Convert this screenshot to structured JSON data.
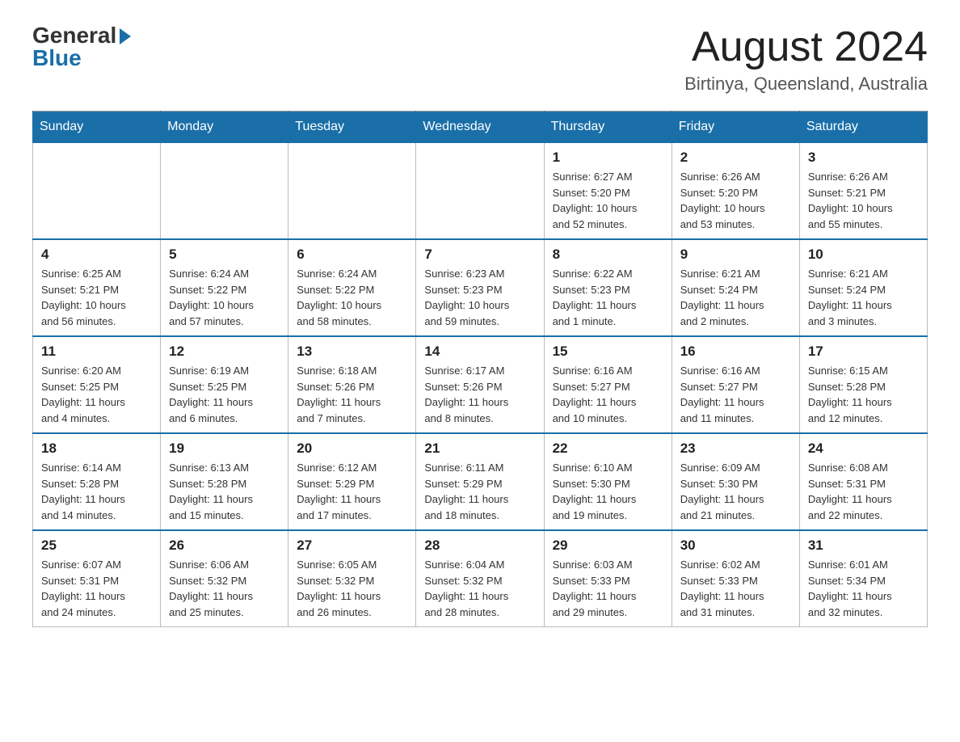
{
  "header": {
    "logo_general": "General",
    "logo_blue": "Blue",
    "month_title": "August 2024",
    "location": "Birtinya, Queensland, Australia"
  },
  "days_of_week": [
    "Sunday",
    "Monday",
    "Tuesday",
    "Wednesday",
    "Thursday",
    "Friday",
    "Saturday"
  ],
  "weeks": [
    [
      {
        "day": "",
        "info": ""
      },
      {
        "day": "",
        "info": ""
      },
      {
        "day": "",
        "info": ""
      },
      {
        "day": "",
        "info": ""
      },
      {
        "day": "1",
        "info": "Sunrise: 6:27 AM\nSunset: 5:20 PM\nDaylight: 10 hours\nand 52 minutes."
      },
      {
        "day": "2",
        "info": "Sunrise: 6:26 AM\nSunset: 5:20 PM\nDaylight: 10 hours\nand 53 minutes."
      },
      {
        "day": "3",
        "info": "Sunrise: 6:26 AM\nSunset: 5:21 PM\nDaylight: 10 hours\nand 55 minutes."
      }
    ],
    [
      {
        "day": "4",
        "info": "Sunrise: 6:25 AM\nSunset: 5:21 PM\nDaylight: 10 hours\nand 56 minutes."
      },
      {
        "day": "5",
        "info": "Sunrise: 6:24 AM\nSunset: 5:22 PM\nDaylight: 10 hours\nand 57 minutes."
      },
      {
        "day": "6",
        "info": "Sunrise: 6:24 AM\nSunset: 5:22 PM\nDaylight: 10 hours\nand 58 minutes."
      },
      {
        "day": "7",
        "info": "Sunrise: 6:23 AM\nSunset: 5:23 PM\nDaylight: 10 hours\nand 59 minutes."
      },
      {
        "day": "8",
        "info": "Sunrise: 6:22 AM\nSunset: 5:23 PM\nDaylight: 11 hours\nand 1 minute."
      },
      {
        "day": "9",
        "info": "Sunrise: 6:21 AM\nSunset: 5:24 PM\nDaylight: 11 hours\nand 2 minutes."
      },
      {
        "day": "10",
        "info": "Sunrise: 6:21 AM\nSunset: 5:24 PM\nDaylight: 11 hours\nand 3 minutes."
      }
    ],
    [
      {
        "day": "11",
        "info": "Sunrise: 6:20 AM\nSunset: 5:25 PM\nDaylight: 11 hours\nand 4 minutes."
      },
      {
        "day": "12",
        "info": "Sunrise: 6:19 AM\nSunset: 5:25 PM\nDaylight: 11 hours\nand 6 minutes."
      },
      {
        "day": "13",
        "info": "Sunrise: 6:18 AM\nSunset: 5:26 PM\nDaylight: 11 hours\nand 7 minutes."
      },
      {
        "day": "14",
        "info": "Sunrise: 6:17 AM\nSunset: 5:26 PM\nDaylight: 11 hours\nand 8 minutes."
      },
      {
        "day": "15",
        "info": "Sunrise: 6:16 AM\nSunset: 5:27 PM\nDaylight: 11 hours\nand 10 minutes."
      },
      {
        "day": "16",
        "info": "Sunrise: 6:16 AM\nSunset: 5:27 PM\nDaylight: 11 hours\nand 11 minutes."
      },
      {
        "day": "17",
        "info": "Sunrise: 6:15 AM\nSunset: 5:28 PM\nDaylight: 11 hours\nand 12 minutes."
      }
    ],
    [
      {
        "day": "18",
        "info": "Sunrise: 6:14 AM\nSunset: 5:28 PM\nDaylight: 11 hours\nand 14 minutes."
      },
      {
        "day": "19",
        "info": "Sunrise: 6:13 AM\nSunset: 5:28 PM\nDaylight: 11 hours\nand 15 minutes."
      },
      {
        "day": "20",
        "info": "Sunrise: 6:12 AM\nSunset: 5:29 PM\nDaylight: 11 hours\nand 17 minutes."
      },
      {
        "day": "21",
        "info": "Sunrise: 6:11 AM\nSunset: 5:29 PM\nDaylight: 11 hours\nand 18 minutes."
      },
      {
        "day": "22",
        "info": "Sunrise: 6:10 AM\nSunset: 5:30 PM\nDaylight: 11 hours\nand 19 minutes."
      },
      {
        "day": "23",
        "info": "Sunrise: 6:09 AM\nSunset: 5:30 PM\nDaylight: 11 hours\nand 21 minutes."
      },
      {
        "day": "24",
        "info": "Sunrise: 6:08 AM\nSunset: 5:31 PM\nDaylight: 11 hours\nand 22 minutes."
      }
    ],
    [
      {
        "day": "25",
        "info": "Sunrise: 6:07 AM\nSunset: 5:31 PM\nDaylight: 11 hours\nand 24 minutes."
      },
      {
        "day": "26",
        "info": "Sunrise: 6:06 AM\nSunset: 5:32 PM\nDaylight: 11 hours\nand 25 minutes."
      },
      {
        "day": "27",
        "info": "Sunrise: 6:05 AM\nSunset: 5:32 PM\nDaylight: 11 hours\nand 26 minutes."
      },
      {
        "day": "28",
        "info": "Sunrise: 6:04 AM\nSunset: 5:32 PM\nDaylight: 11 hours\nand 28 minutes."
      },
      {
        "day": "29",
        "info": "Sunrise: 6:03 AM\nSunset: 5:33 PM\nDaylight: 11 hours\nand 29 minutes."
      },
      {
        "day": "30",
        "info": "Sunrise: 6:02 AM\nSunset: 5:33 PM\nDaylight: 11 hours\nand 31 minutes."
      },
      {
        "day": "31",
        "info": "Sunrise: 6:01 AM\nSunset: 5:34 PM\nDaylight: 11 hours\nand 32 minutes."
      }
    ]
  ]
}
